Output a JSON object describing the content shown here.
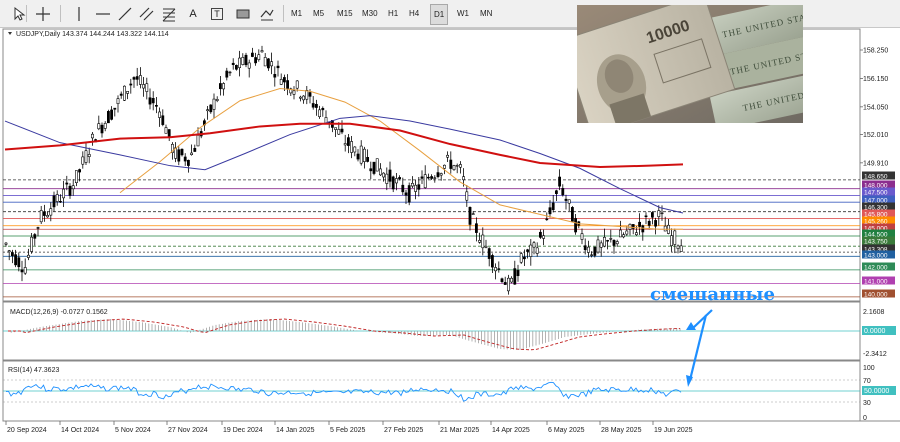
{
  "toolbar": {
    "tools": [
      {
        "name": "cursor-tool-button",
        "icon": "arrow-cursor-icon"
      },
      {
        "name": "crosshair-tool-button",
        "icon": "crosshair-icon"
      },
      {
        "name": "vertical-line-tool-button",
        "icon": "vertical-line-icon"
      },
      {
        "name": "horizontal-line-tool-button",
        "icon": "horizontal-line-icon"
      },
      {
        "name": "trendline-tool-button",
        "icon": "trendline-icon"
      },
      {
        "name": "channel-tool-button",
        "icon": "channel-icon"
      },
      {
        "name": "fibonacci-tool-button",
        "icon": "fibonacci-icon"
      },
      {
        "name": "text-tool-button",
        "icon": "text-icon"
      },
      {
        "name": "text-label-tool-button",
        "icon": "text-label-icon"
      },
      {
        "name": "rectangle-tool-button",
        "icon": "rectangle-icon"
      },
      {
        "name": "shapes-menu-button",
        "icon": "shapes-icon"
      }
    ],
    "text_label_glyph": "A",
    "text_label_box_glyph": "T",
    "timeframes": [
      "M1",
      "M5",
      "M15",
      "M30",
      "H1",
      "H4",
      "D1",
      "W1",
      "MN"
    ],
    "active_timeframe": "D1"
  },
  "chart": {
    "symbol_label": "USDJPY,Daily  143.374 144.244 143.322 144.114",
    "macd_label": "MACD(12,26,9) -0.0727 0.1562",
    "rsi_label": "RSI(14) 47.3623",
    "annotation_text": "смешанные",
    "price_scale": [
      "158.250",
      "156.150",
      "154.050",
      "152.010",
      "149.910"
    ],
    "level_labels": [
      {
        "text": "148.650",
        "color": "#333333"
      },
      {
        "text": "148.000",
        "color": "#8b2d8e"
      },
      {
        "text": "147.500",
        "color": "#6a5acd"
      },
      {
        "text": "147.000",
        "color": "#4060c0"
      },
      {
        "text": "146.300",
        "color": "#333333"
      },
      {
        "text": "145.800",
        "color": "#e05858"
      },
      {
        "text": "145.260",
        "color": "#ff8c00"
      },
      {
        "text": "145.000",
        "color": "#c04040"
      },
      {
        "text": "144.500",
        "color": "#208040"
      },
      {
        "text": "143.750",
        "color": "#3a7a3a"
      },
      {
        "text": "143.308",
        "color": "#333333"
      },
      {
        "text": "143.000",
        "color": "#2060a0"
      },
      {
        "text": "142.000",
        "color": "#2e8b57"
      },
      {
        "text": "141.000",
        "color": "#b040b0"
      },
      {
        "text": "140.000",
        "color": "#a05030"
      }
    ],
    "macd_scale": [
      "2.1608",
      "0.0000",
      "-2.3412"
    ],
    "rsi_scale": [
      "100",
      "70",
      "50.0000",
      "30",
      "0"
    ],
    "date_labels": [
      "20 Sep 2024",
      "14 Oct 2024",
      "5 Nov 2024",
      "27 Nov 2024",
      "19 Dec 2024",
      "14 Jan 2025",
      "5 Feb 2025",
      "27 Feb 2025",
      "21 Mar 2025",
      "14 Apr 2025",
      "6 May 2025",
      "28 May 2025",
      "19 Jun 2025"
    ],
    "colors": {
      "ma_fast": "#e8a040",
      "ma_slow": "#3a3aa0",
      "ma_200": "#d01010",
      "candles": "#000000",
      "macd_signal": "#c02020",
      "rsi_line": "#1e90ff",
      "annotation": "#1e8fff"
    }
  }
}
